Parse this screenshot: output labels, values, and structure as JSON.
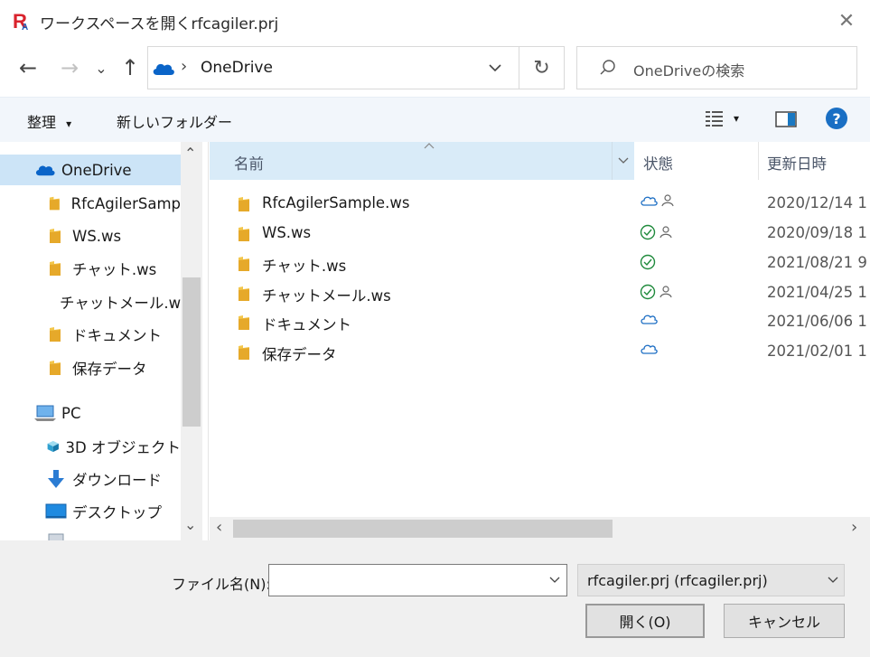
{
  "window": {
    "title": "ワークスペースを開くrfcagiler.prj",
    "close_symbol": "✕"
  },
  "nav": {
    "back": "←",
    "forward": "→",
    "recent": "⌄",
    "up": "↑",
    "address": {
      "separator": "›",
      "location": "OneDrive"
    },
    "refresh": "↻",
    "search_placeholder": "OneDriveの検索"
  },
  "toolbar": {
    "organize_label": "整理",
    "organize_arrow": "▾",
    "new_folder_label": "新しいフォルダー",
    "view_arrow": "▾",
    "help_symbol": "?"
  },
  "sidebar": {
    "items": [
      {
        "label": "OneDrive",
        "icon": "cloud-icon"
      },
      {
        "label": "RfcAgilerSamp",
        "icon": "folder-icon"
      },
      {
        "label": "WS.ws",
        "icon": "folder-icon"
      },
      {
        "label": "チャット.ws",
        "icon": "folder-icon"
      },
      {
        "label": "チャットメール.ws",
        "icon": "folder-icon"
      },
      {
        "label": "ドキュメント",
        "icon": "folder-icon"
      },
      {
        "label": "保存データ",
        "icon": "folder-icon"
      },
      {
        "label": "PC",
        "icon": "pc-icon"
      },
      {
        "label": "3D オブジェクト",
        "icon": "3d-objects-icon"
      },
      {
        "label": "ダウンロード",
        "icon": "download-icon"
      },
      {
        "label": "デスクトップ",
        "icon": "desktop-icon"
      }
    ],
    "scroll_up": "⌃",
    "scroll_down": "⌄"
  },
  "columns": {
    "name": "名前",
    "status": "状態",
    "modified": "更新日時"
  },
  "files": [
    {
      "name": "RfcAgilerSample.ws",
      "status": [
        "cloud",
        "shared"
      ],
      "modified": "2020/12/14 1"
    },
    {
      "name": "WS.ws",
      "status": [
        "synced",
        "shared"
      ],
      "modified": "2020/09/18 1"
    },
    {
      "name": "チャット.ws",
      "status": [
        "synced"
      ],
      "modified": "2021/08/21 9"
    },
    {
      "name": "チャットメール.ws",
      "status": [
        "synced",
        "shared"
      ],
      "modified": "2021/04/25 1"
    },
    {
      "name": "ドキュメント",
      "status": [
        "cloud"
      ],
      "modified": "2021/06/06 1"
    },
    {
      "name": "保存データ",
      "status": [
        "cloud"
      ],
      "modified": "2021/02/01 1"
    }
  ],
  "hscroll": {
    "left": "‹",
    "right": "›"
  },
  "footer": {
    "filename_label": "ファイル名(N):",
    "filename_value": "",
    "filetype_value": "rfcagiler.prj (rfcagiler.prj)",
    "open_label": "開く(O)",
    "cancel_label": "キャンセル"
  },
  "colors": {
    "accent": "#0078d4",
    "selected": "#cce4f7",
    "header": "#d9ebf8",
    "folder": "#f3c64b"
  }
}
